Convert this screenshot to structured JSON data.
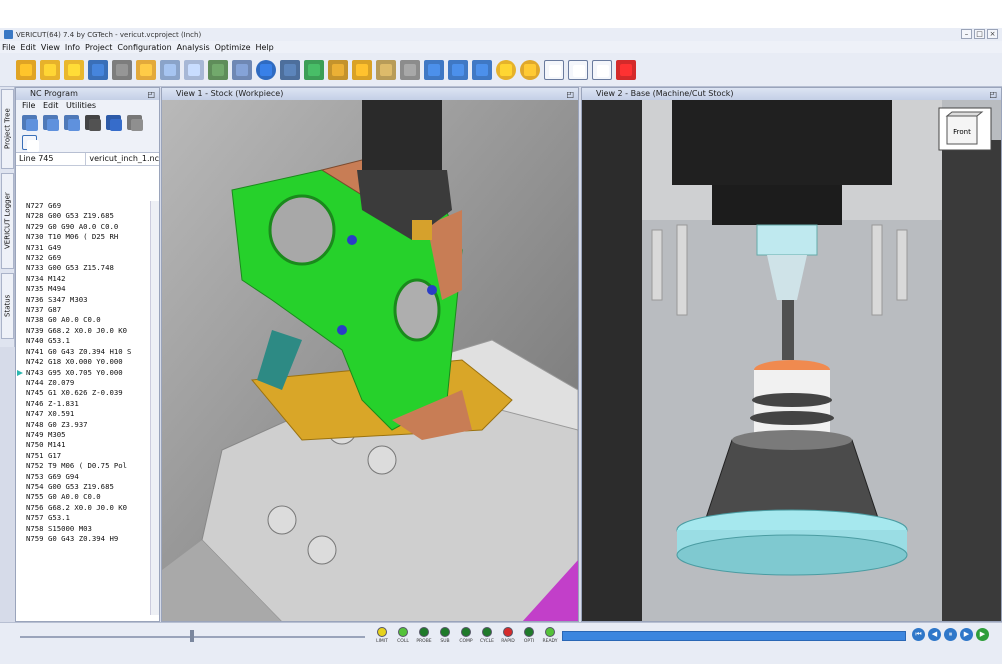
{
  "window": {
    "title": "VERICUT(64) 7.4 by CGTech - vericut.vcproject (Inch)"
  },
  "menu": [
    "File",
    "Edit",
    "View",
    "Info",
    "Project",
    "Configuration",
    "Analysis",
    "Optimize",
    "Help"
  ],
  "side_tabs": [
    "Project Tree",
    "VERICUT Logger",
    "Status"
  ],
  "nc_program": {
    "title": "NC Program",
    "menu": [
      "File",
      "Edit",
      "Utilities"
    ],
    "line_label": "Line 745",
    "file_name": "vericut_inch_1.nc",
    "lines": [
      "N727 G69",
      "N728 G00 G53 Z19.685",
      "N729 G0 G90 A0.0 C0.0",
      "N730 T10 M06  ( D25 RH",
      "N731 G49",
      "N732 G69",
      "N733 G00 G53 Z15.748",
      "N734 M142",
      "N735 M494",
      "N736 S347 M303",
      "N737 G87",
      "N738 G0 A0.0 C0.0",
      "N739 G68.2 X0.0 J0.0 K0",
      "N740 G53.1",
      "N741 G0 G43 Z0.394 H10 S",
      "N742 G18 X0.000 Y0.000",
      "N743 G95 X0.705 Y0.000",
      "N744 Z0.079",
      "N745 G1 X0.626 Z-0.039",
      "N746 Z-1.831",
      "N747 X0.591",
      "N748 G0 Z3.937",
      "N749 M305",
      "N750 M141",
      "N751 G17",
      "N752 T9 M06  ( D0.75 Pol",
      "N753 G69 G94",
      "N754 G00 G53 Z19.685",
      "N755 G0 A0.0 C0.0",
      "N756 G68.2 X0.0 J0.0 K0",
      "N757 G53.1",
      "N758 S15000 M03",
      "N759 G0 G43 Z0.394 H9"
    ],
    "current_index": 16
  },
  "views": {
    "view1": {
      "title": "View 1 - Stock (Workpiece)"
    },
    "view2": {
      "title": "View 2 - Base (Machine/Cut Stock)",
      "cube_label": "Front"
    }
  },
  "status_leds": [
    {
      "label": "LIMIT",
      "color": "#e6d21c"
    },
    {
      "label": "COLL",
      "color": "#54c23a"
    },
    {
      "label": "PROBE",
      "color": "#1f7a2a"
    },
    {
      "label": "SUB",
      "color": "#1f7a2a"
    },
    {
      "label": "COMP",
      "color": "#1f7a2a"
    },
    {
      "label": "CYCLE",
      "color": "#1f7a2a"
    },
    {
      "label": "RAPID",
      "color": "#d52b2b"
    },
    {
      "label": "OPTI",
      "color": "#1f7a2a"
    },
    {
      "label": "READY",
      "color": "#54c23a"
    }
  ],
  "colors": {
    "accent": "#3c86df",
    "nc_marker": "#2bb7b0"
  }
}
